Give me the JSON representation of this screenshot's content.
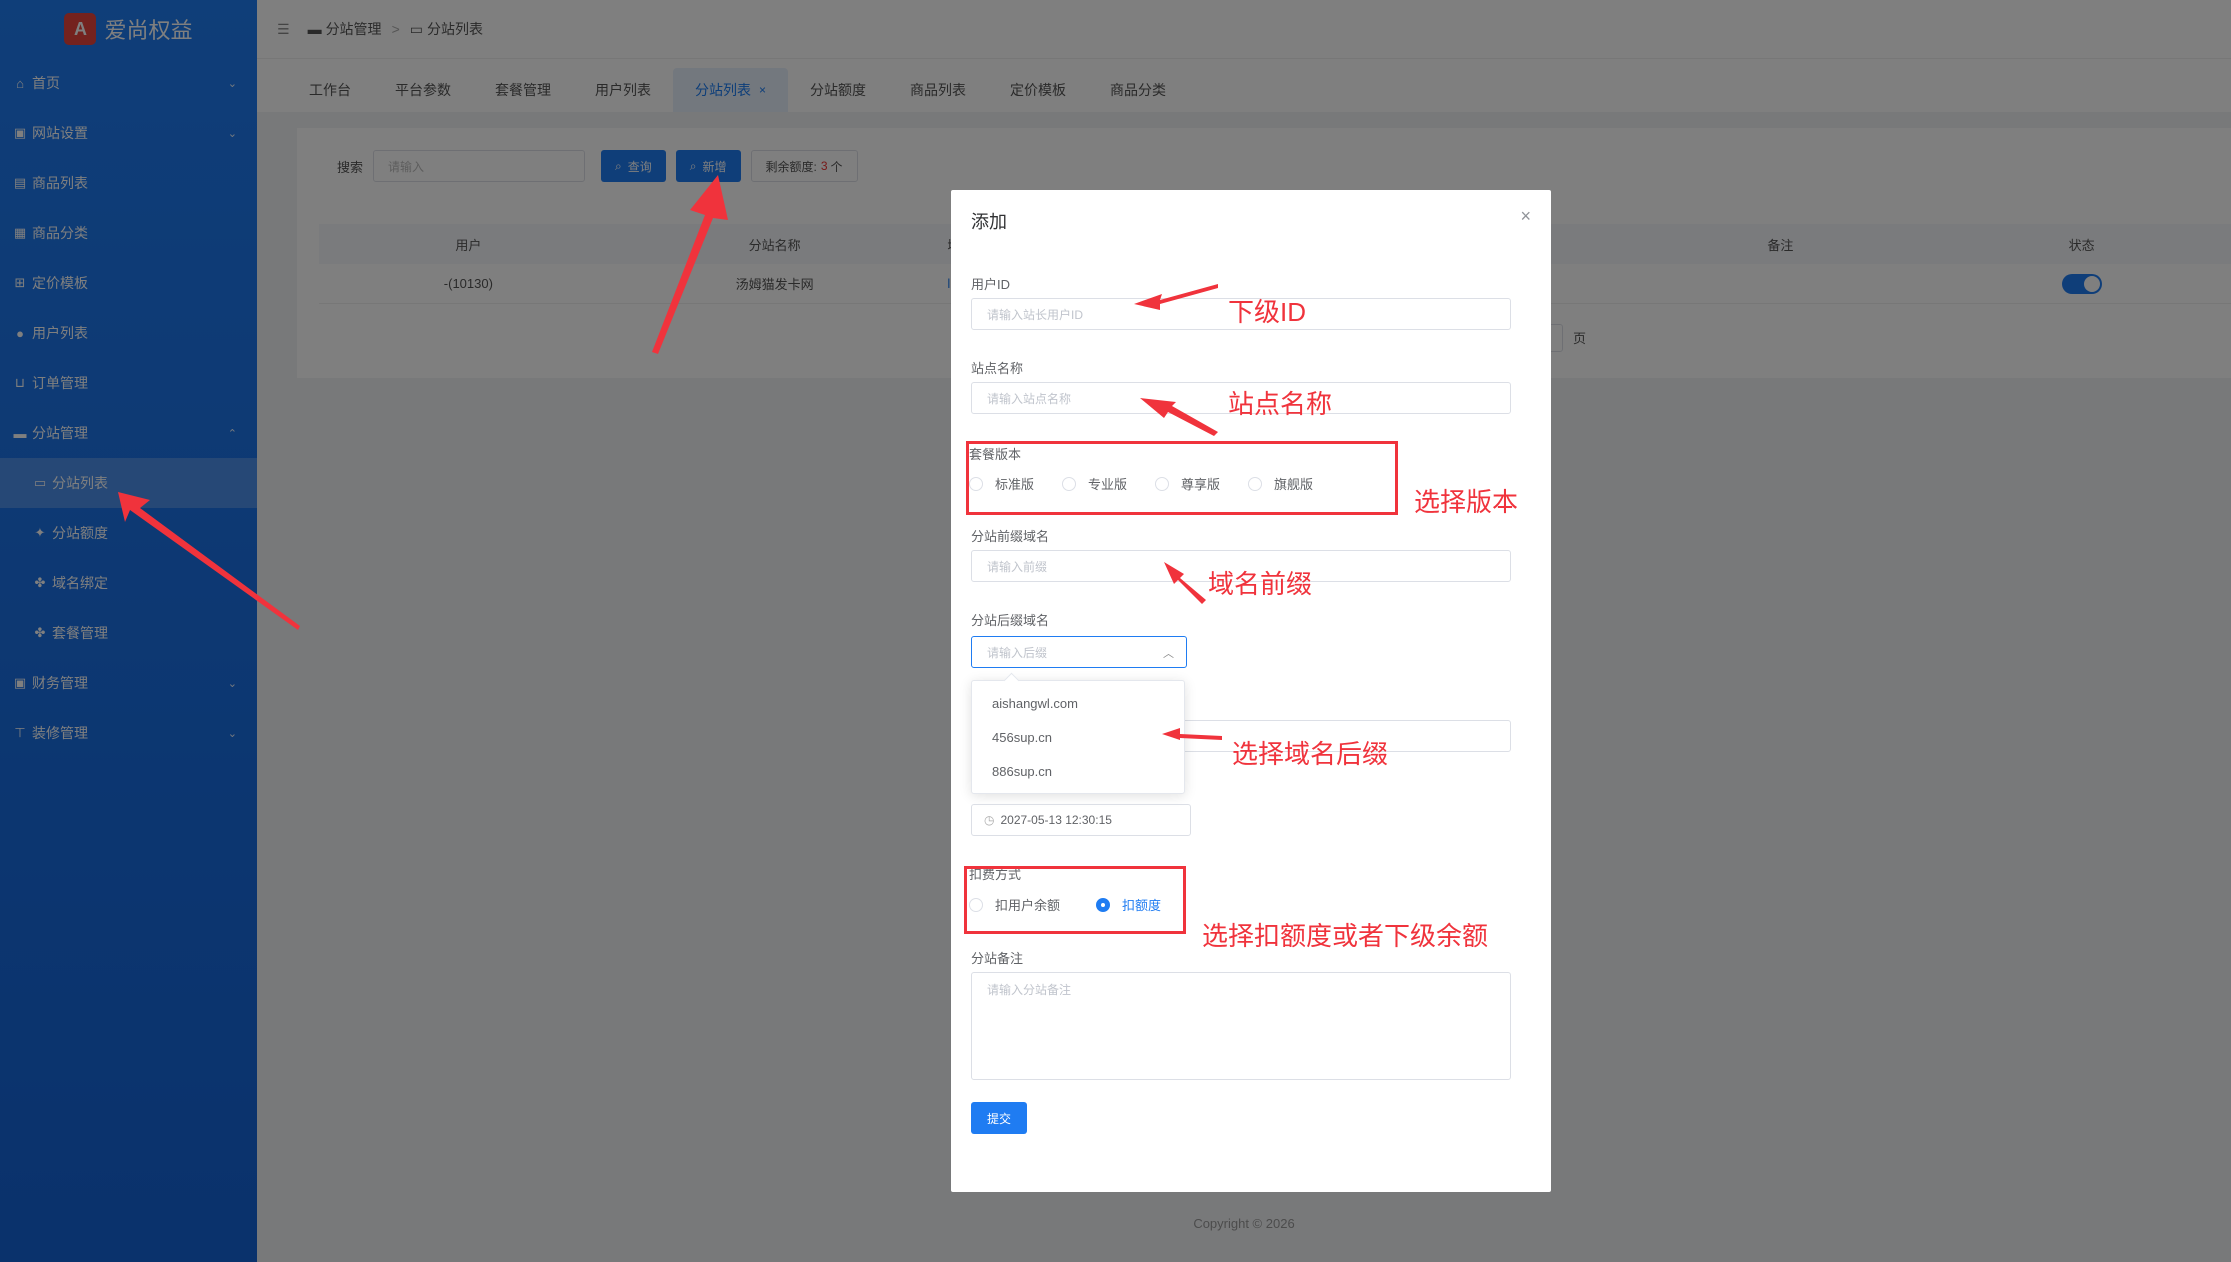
{
  "sidebar": {
    "logo_mark": "A",
    "logo_text": "爱尚权益",
    "items": [
      {
        "label": "首页",
        "icon": "⌂",
        "chevron": "⌄",
        "sub": false,
        "active": false
      },
      {
        "label": "网站设置",
        "icon": "▣",
        "chevron": "⌄",
        "sub": false,
        "active": false
      },
      {
        "label": "商品列表",
        "icon": "▤",
        "chevron": "",
        "sub": false,
        "active": false
      },
      {
        "label": "商品分类",
        "icon": "▦",
        "chevron": "",
        "sub": false,
        "active": false
      },
      {
        "label": "定价模板",
        "icon": "⊞",
        "chevron": "",
        "sub": false,
        "active": false
      },
      {
        "label": "用户列表",
        "icon": "●",
        "chevron": "",
        "sub": false,
        "active": false
      },
      {
        "label": "订单管理",
        "icon": "⊔",
        "chevron": "",
        "sub": false,
        "active": false
      },
      {
        "label": "分站管理",
        "icon": "▬",
        "chevron": "⌃",
        "sub": false,
        "active": false
      },
      {
        "label": "分站列表",
        "icon": "▭",
        "chevron": "",
        "sub": true,
        "active": true
      },
      {
        "label": "分站额度",
        "icon": "✦",
        "chevron": "",
        "sub": true,
        "active": false
      },
      {
        "label": "域名绑定",
        "icon": "✤",
        "chevron": "",
        "sub": true,
        "active": false
      },
      {
        "label": "套餐管理",
        "icon": "✤",
        "chevron": "",
        "sub": true,
        "active": false
      },
      {
        "label": "财务管理",
        "icon": "▣",
        "chevron": "⌄",
        "sub": false,
        "active": false
      },
      {
        "label": "装修管理",
        "icon": "⊤",
        "chevron": "⌄",
        "sub": false,
        "active": false
      }
    ]
  },
  "topbar": {
    "menu_icon": "☰",
    "crumb1": "分站管理",
    "crumb_sep": ">",
    "crumb2": "分站列表"
  },
  "tabs": [
    {
      "label": "工作台",
      "active": false
    },
    {
      "label": "平台参数",
      "active": false
    },
    {
      "label": "套餐管理",
      "active": false
    },
    {
      "label": "用户列表",
      "active": false
    },
    {
      "label": "分站列表",
      "active": true
    },
    {
      "label": "分站额度",
      "active": false
    },
    {
      "label": "商品列表",
      "active": false
    },
    {
      "label": "定价模板",
      "active": false
    },
    {
      "label": "商品分类",
      "active": false
    }
  ],
  "tab_close": "×",
  "search": {
    "label": "搜索",
    "placeholder": "请输入",
    "query_btn": "查询",
    "add_btn": "新增",
    "quota_label": "剩余额度:",
    "quota_value": "3",
    "quota_unit": "个"
  },
  "table": {
    "headers": [
      "用户",
      "分站名称",
      "域",
      "备注",
      "状态"
    ],
    "rows": [
      {
        "user": "-(10130)",
        "site": "汤姆猫发卡网",
        "domain": "li",
        "note": ""
      }
    ],
    "page_suffix": "页"
  },
  "footer": "Copyright © 2026",
  "dialog": {
    "title": "添加",
    "close": "×",
    "user_id_label": "用户ID",
    "user_id_placeholder": "请输入站长用户ID",
    "site_name_label": "站点名称",
    "site_name_placeholder": "请输入站点名称",
    "plan_label": "套餐版本",
    "plans": [
      "标准版",
      "专业版",
      "尊享版",
      "旗舰版"
    ],
    "prefix_label": "分站前缀域名",
    "prefix_placeholder": "请输入前缀",
    "suffix_label": "分站后缀域名",
    "suffix_placeholder": "请输入后缀",
    "suffix_options": [
      "aishangwl.com",
      "456sup.cn",
      "886sup.cn"
    ],
    "expire_value": "2027-05-13 12:30:15",
    "deduct_label": "扣费方式",
    "deduct_options": [
      "扣用户余额",
      "扣额度"
    ],
    "deduct_selected": "扣额度",
    "remark_label": "分站备注",
    "remark_placeholder": "请输入分站备注",
    "submit": "提交"
  },
  "annotations": {
    "user_id": "下级ID",
    "site_name": "站点名称",
    "plan": "选择版本",
    "prefix": "域名前缀",
    "suffix": "选择域名后缀",
    "deduct": "选择扣额度或者下级余额"
  },
  "colors": {
    "primary": "#1f7cf2",
    "annotation": "#f0333c",
    "sidebar_top": "#1f7cf2",
    "sidebar_bottom": "#1564d8"
  }
}
